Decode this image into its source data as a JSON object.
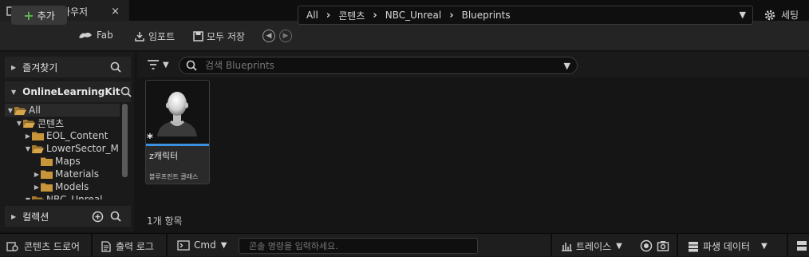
{
  "tab": {
    "title": "콘텐츠 브라우저",
    "close": "×"
  },
  "toolbar": {
    "add_label": "추가",
    "fab_label": "Fab",
    "import_label": "임포트",
    "save_all_label": "모두 저장",
    "settings_label": "세팅"
  },
  "breadcrumb": [
    "All",
    "콘텐츠",
    "NBC_Unreal",
    "Blueprints"
  ],
  "sidebar": {
    "favorites_label": "즐겨찾기",
    "project_label": "OnlineLearningKit",
    "collections_label": "컬렉션",
    "tree": [
      {
        "label": "All",
        "indent": 0,
        "expanded": true
      },
      {
        "label": "콘텐츠",
        "indent": 1,
        "expanded": true
      },
      {
        "label": "EOL_Content",
        "indent": 2,
        "expanded": false
      },
      {
        "label": "LowerSector_M",
        "indent": 2,
        "expanded": true
      },
      {
        "label": "Maps",
        "indent": 3,
        "expanded": null
      },
      {
        "label": "Materials",
        "indent": 3,
        "expanded": false
      },
      {
        "label": "Models",
        "indent": 3,
        "expanded": false
      },
      {
        "label": "NBC_Unreal",
        "indent": 2,
        "expanded": true
      }
    ]
  },
  "search": {
    "placeholder": "검색 Blueprints"
  },
  "asset": {
    "name": "z캐릭터",
    "type": "블루프린트 클래스",
    "marker": "*"
  },
  "item_count": "1개 항목",
  "bottom": {
    "content_drawer": "콘텐츠 드로어",
    "output_log": "출력 로그",
    "cmd": "Cmd",
    "console_placeholder": "콘솔 명령을 입력하세요.",
    "trace": "트레이스",
    "derived_data": "파생 데이터"
  },
  "colors": {
    "accent_blue": "#3d8fe0",
    "add_green": "#5bb84a",
    "folder": "#c9953a"
  }
}
